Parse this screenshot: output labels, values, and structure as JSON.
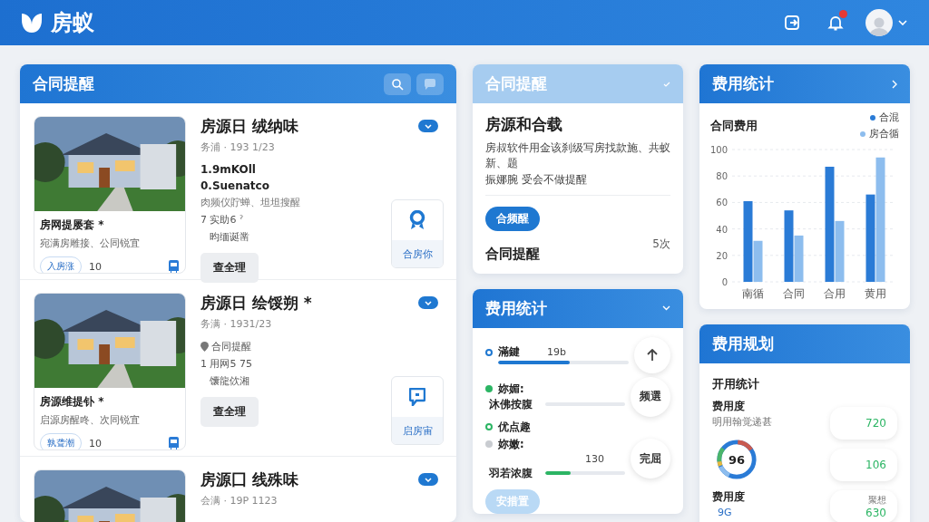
{
  "header": {
    "brand": "房蚁",
    "notification_badge": true
  },
  "listings_panel": {
    "title": "合同提醒",
    "listings": [
      {
        "card_title": "房网提屡套 *",
        "card_subtitle": "宛满房雕接、公同锐宜",
        "tag": "入房涨",
        "count": "10",
        "title": "房源日 绒纳味",
        "subtitle": "务浦 · 193 1/23",
        "lines": [
          {
            "kind": "strong",
            "text": "1.9mKOll"
          },
          {
            "kind": "strong",
            "text": "0.Suenatco"
          },
          {
            "kind": "muted",
            "text": "肉频仪貯蝉、坦坦搜醒"
          },
          {
            "kind": "plain",
            "text": "7 实助6 ˀ"
          },
          {
            "kind": "indent",
            "text": "昀缅诞凿"
          }
        ],
        "button": "查全理",
        "action": {
          "kind": "pin",
          "label": "合房你"
        }
      },
      {
        "card_title": "房源维提钋 *",
        "card_subtitle": "启源房醒咚、次同锐宜",
        "tag": "孰聋潮",
        "count": "10",
        "title": "房源日 绘馁朔 *",
        "subtitle": "务满 · 1931/23",
        "lines": [
          {
            "kind": "pin",
            "text": "合同提醒"
          },
          {
            "kind": "plain",
            "text": "1 用网5 75"
          },
          {
            "kind": "indent",
            "text": "馕龍佽湘"
          }
        ],
        "button": "查全理",
        "action": {
          "kind": "chat",
          "label": "启房宙"
        }
      },
      {
        "title": "房源囗 线殊味",
        "subtitle": "会满 · 19P 1123"
      }
    ]
  },
  "reminder_panel": {
    "title": "合同提醒",
    "heading": "房源和合载",
    "paragraphs": [
      "房叔软件用金该刹级写房找款施、共蚁新、题",
      "振娜腕 受会不做提醒"
    ],
    "button": "合频醒",
    "footer_label": "合同提醒",
    "footer_count": "5次"
  },
  "fees_panel": {
    "title": "费用统计",
    "rows": [
      {
        "kind": "ring",
        "color": "#1f78d1",
        "label": "滿鍵",
        "value": "19b",
        "bar": {
          "level": 0.55,
          "color": "#1f78d1"
        },
        "action": {
          "kind": "arrow"
        }
      },
      {
        "kind": "solid",
        "color": "#2cb564",
        "label": "妳媚:",
        "sublabel": "沐佛按腹",
        "bar": {
          "level": 0
        },
        "action": {
          "kind": "text",
          "label": "频選"
        }
      },
      {
        "kind": "ring",
        "color": "#2cb564",
        "label": "优点趣"
      },
      {
        "kind": "solid",
        "color": "#c9ccd1",
        "label": "妳嫩:",
        "sublabel": "羽若浓腹",
        "value": "130",
        "bar": {
          "level": 0.32,
          "color": "#2cb564"
        },
        "action": {
          "kind": "text",
          "label": "完屈"
        }
      }
    ],
    "bottom_button": "安措置"
  },
  "chart_panel": {
    "title": "费用统计",
    "chart_title": "合同费用",
    "chart_data": {
      "type": "bar",
      "categories": [
        "南循",
        "合同",
        "合用",
        "黄用"
      ],
      "series": [
        {
          "name": "合混",
          "color": "#2a7bd6",
          "values": [
            61,
            54,
            87,
            66
          ]
        },
        {
          "name": "房合循",
          "color": "#8dbdee",
          "values": [
            31,
            35,
            46,
            94
          ]
        }
      ],
      "ylim": [
        0,
        100
      ],
      "yticks": [
        0,
        20,
        40,
        60,
        80,
        100
      ],
      "grid": true
    }
  },
  "plan_panel": {
    "title": "费用规划",
    "heading": "开用统计",
    "label": "费用度",
    "sublabel": "明用翰觉递甚",
    "donut_value": "96",
    "bottom_label": "费用度",
    "bottom_value": "9G",
    "bubbles": [
      {
        "value": "720"
      },
      {
        "value": "106"
      },
      {
        "caption": "聚想",
        "value": "630"
      }
    ]
  }
}
